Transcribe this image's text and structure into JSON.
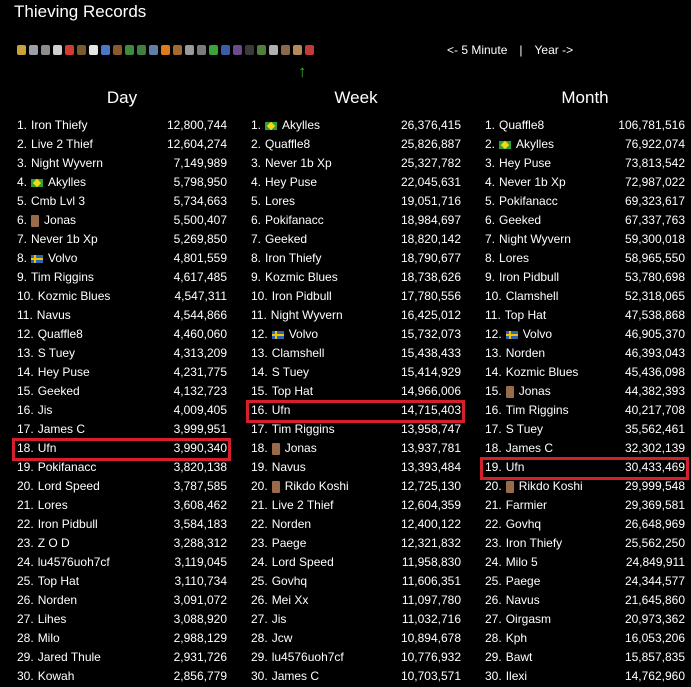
{
  "title": "Thieving Records",
  "skill_icons": [
    {
      "name": "overall-icon",
      "color": "#c9a23a"
    },
    {
      "name": "attack-icon",
      "color": "#9aa0a6"
    },
    {
      "name": "defence-icon",
      "color": "#8c8c8c"
    },
    {
      "name": "strength-icon",
      "color": "#cfcfcf"
    },
    {
      "name": "hitpoints-icon",
      "color": "#d33b2c"
    },
    {
      "name": "ranged-icon",
      "color": "#7a5a2a"
    },
    {
      "name": "prayer-icon",
      "color": "#e6e6e6"
    },
    {
      "name": "magic-icon",
      "color": "#4a78c7"
    },
    {
      "name": "cooking-icon",
      "color": "#8b5a2b"
    },
    {
      "name": "woodcutting-icon",
      "color": "#3c8c3c"
    },
    {
      "name": "fletching-icon",
      "color": "#3f7f3f"
    },
    {
      "name": "fishing-icon",
      "color": "#5f7fa8"
    },
    {
      "name": "firemaking-icon",
      "color": "#e07b1a"
    },
    {
      "name": "crafting-icon",
      "color": "#a36a2e"
    },
    {
      "name": "smithing-icon",
      "color": "#9a9a9a"
    },
    {
      "name": "mining-icon",
      "color": "#7a7a7a"
    },
    {
      "name": "herblore-icon",
      "color": "#3aa53a"
    },
    {
      "name": "agility-icon",
      "color": "#3b5da8"
    },
    {
      "name": "thieving-icon",
      "color": "#6a4c8c"
    },
    {
      "name": "slayer-icon",
      "color": "#3a3a3a"
    },
    {
      "name": "farming-icon",
      "color": "#4f7f3a"
    },
    {
      "name": "runecraft-icon",
      "color": "#b0b0b0"
    },
    {
      "name": "hunter-icon",
      "color": "#8a6a4a"
    },
    {
      "name": "construction-icon",
      "color": "#b58a5a"
    },
    {
      "name": "ehp-icon",
      "color": "#c23b3b"
    }
  ],
  "nav": {
    "prev": "<- 5 Minute",
    "separator": "|",
    "next": "Year ->"
  },
  "columns": [
    {
      "title": "Day",
      "rows": [
        {
          "rank": "1.",
          "name": "Iron Thiefy",
          "value": "12,800,744"
        },
        {
          "rank": "2.",
          "name": "Live 2 Thief",
          "value": "12,604,274"
        },
        {
          "rank": "3.",
          "name": "Night Wyvern",
          "value": "7,149,989"
        },
        {
          "rank": "4.",
          "name": "Akylles",
          "value": "5,798,950",
          "flag": "br"
        },
        {
          "rank": "5.",
          "name": "Cmb Lvl 3",
          "value": "5,734,663"
        },
        {
          "rank": "6.",
          "name": "Jonas",
          "value": "5,500,407",
          "avatar": true
        },
        {
          "rank": "7.",
          "name": "Never 1b Xp",
          "value": "5,269,850"
        },
        {
          "rank": "8.",
          "name": "Volvo",
          "value": "4,801,559",
          "flag": "se"
        },
        {
          "rank": "9.",
          "name": "Tim Riggins",
          "value": "4,617,485"
        },
        {
          "rank": "10.",
          "name": "Kozmic Blues",
          "value": "4,547,311"
        },
        {
          "rank": "11.",
          "name": "Navus",
          "value": "4,544,866"
        },
        {
          "rank": "12.",
          "name": "Quaffle8",
          "value": "4,460,060"
        },
        {
          "rank": "13.",
          "name": "S Tuey",
          "value": "4,313,209"
        },
        {
          "rank": "14.",
          "name": "Hey Puse",
          "value": "4,231,775"
        },
        {
          "rank": "15.",
          "name": "Geeked",
          "value": "4,132,723"
        },
        {
          "rank": "16.",
          "name": "Jis",
          "value": "4,009,405"
        },
        {
          "rank": "17.",
          "name": "James C",
          "value": "3,999,951"
        },
        {
          "rank": "18.",
          "name": "Ufn",
          "value": "3,990,340",
          "highlight": true
        },
        {
          "rank": "19.",
          "name": "Pokifanacc",
          "value": "3,820,138"
        },
        {
          "rank": "20.",
          "name": "Lord Speed",
          "value": "3,787,585"
        },
        {
          "rank": "21.",
          "name": "Lores",
          "value": "3,608,462"
        },
        {
          "rank": "22.",
          "name": "Iron Pidbull",
          "value": "3,584,183"
        },
        {
          "rank": "23.",
          "name": "Z O D",
          "value": "3,288,312"
        },
        {
          "rank": "24.",
          "name": "lu4576uoh7cf",
          "value": "3,119,045"
        },
        {
          "rank": "25.",
          "name": "Top Hat",
          "value": "3,110,734"
        },
        {
          "rank": "26.",
          "name": "Norden",
          "value": "3,091,072"
        },
        {
          "rank": "27.",
          "name": "Lihes",
          "value": "3,088,920"
        },
        {
          "rank": "28.",
          "name": "Milo",
          "value": "2,988,129"
        },
        {
          "rank": "29.",
          "name": "Jared Thule",
          "value": "2,931,726"
        },
        {
          "rank": "30.",
          "name": "Kowah",
          "value": "2,856,779"
        }
      ]
    },
    {
      "title": "Week",
      "rows": [
        {
          "rank": "1.",
          "name": "Akylles",
          "value": "26,376,415",
          "flag": "br"
        },
        {
          "rank": "2.",
          "name": "Quaffle8",
          "value": "25,826,887"
        },
        {
          "rank": "3.",
          "name": "Never 1b Xp",
          "value": "25,327,782"
        },
        {
          "rank": "4.",
          "name": "Hey Puse",
          "value": "22,045,631"
        },
        {
          "rank": "5.",
          "name": "Lores",
          "value": "19,051,716"
        },
        {
          "rank": "6.",
          "name": "Pokifanacc",
          "value": "18,984,697"
        },
        {
          "rank": "7.",
          "name": "Geeked",
          "value": "18,820,142"
        },
        {
          "rank": "8.",
          "name": "Iron Thiefy",
          "value": "18,790,677"
        },
        {
          "rank": "9.",
          "name": "Kozmic Blues",
          "value": "18,738,626"
        },
        {
          "rank": "10.",
          "name": "Iron Pidbull",
          "value": "17,780,556"
        },
        {
          "rank": "11.",
          "name": "Night Wyvern",
          "value": "16,425,012"
        },
        {
          "rank": "12.",
          "name": "Volvo",
          "value": "15,732,073",
          "flag": "se"
        },
        {
          "rank": "13.",
          "name": "Clamshell",
          "value": "15,438,433"
        },
        {
          "rank": "14.",
          "name": "S Tuey",
          "value": "15,414,929"
        },
        {
          "rank": "15.",
          "name": "Top Hat",
          "value": "14,966,006"
        },
        {
          "rank": "16.",
          "name": "Ufn",
          "value": "14,715,403",
          "highlight": true
        },
        {
          "rank": "17.",
          "name": "Tim Riggins",
          "value": "13,958,747"
        },
        {
          "rank": "18.",
          "name": "Jonas",
          "value": "13,937,781",
          "avatar": true
        },
        {
          "rank": "19.",
          "name": "Navus",
          "value": "13,393,484"
        },
        {
          "rank": "20.",
          "name": "Rikdo Koshi",
          "value": "12,725,130",
          "avatar": true
        },
        {
          "rank": "21.",
          "name": "Live 2 Thief",
          "value": "12,604,359"
        },
        {
          "rank": "22.",
          "name": "Norden",
          "value": "12,400,122"
        },
        {
          "rank": "23.",
          "name": "Paege",
          "value": "12,321,832"
        },
        {
          "rank": "24.",
          "name": "Lord Speed",
          "value": "11,958,830"
        },
        {
          "rank": "25.",
          "name": "Govhq",
          "value": "11,606,351"
        },
        {
          "rank": "26.",
          "name": "Mei Xx",
          "value": "11,097,780"
        },
        {
          "rank": "27.",
          "name": "Jis",
          "value": "11,032,716"
        },
        {
          "rank": "28.",
          "name": "Jcw",
          "value": "10,894,678"
        },
        {
          "rank": "29.",
          "name": "lu4576uoh7cf",
          "value": "10,776,932"
        },
        {
          "rank": "30.",
          "name": "James C",
          "value": "10,703,571"
        }
      ]
    },
    {
      "title": "Month",
      "rows": [
        {
          "rank": "1.",
          "name": "Quaffle8",
          "value": "106,781,516"
        },
        {
          "rank": "2.",
          "name": "Akylles",
          "value": "76,922,074",
          "flag": "br"
        },
        {
          "rank": "3.",
          "name": "Hey Puse",
          "value": "73,813,542"
        },
        {
          "rank": "4.",
          "name": "Never 1b Xp",
          "value": "72,987,022"
        },
        {
          "rank": "5.",
          "name": "Pokifanacc",
          "value": "69,323,617"
        },
        {
          "rank": "6.",
          "name": "Geeked",
          "value": "67,337,763"
        },
        {
          "rank": "7.",
          "name": "Night Wyvern",
          "value": "59,300,018"
        },
        {
          "rank": "8.",
          "name": "Lores",
          "value": "58,965,550"
        },
        {
          "rank": "9.",
          "name": "Iron Pidbull",
          "value": "53,780,698"
        },
        {
          "rank": "10.",
          "name": "Clamshell",
          "value": "52,318,065"
        },
        {
          "rank": "11.",
          "name": "Top Hat",
          "value": "47,538,868"
        },
        {
          "rank": "12.",
          "name": "Volvo",
          "value": "46,905,370",
          "flag": "se"
        },
        {
          "rank": "13.",
          "name": "Norden",
          "value": "46,393,043"
        },
        {
          "rank": "14.",
          "name": "Kozmic Blues",
          "value": "45,436,098"
        },
        {
          "rank": "15.",
          "name": "Jonas",
          "value": "44,382,393",
          "avatar": true
        },
        {
          "rank": "16.",
          "name": "Tim Riggins",
          "value": "40,217,708"
        },
        {
          "rank": "17.",
          "name": "S Tuey",
          "value": "35,562,461"
        },
        {
          "rank": "18.",
          "name": "James C",
          "value": "32,302,139"
        },
        {
          "rank": "19.",
          "name": "Ufn",
          "value": "30,433,469",
          "highlight": true
        },
        {
          "rank": "20.",
          "name": "Rikdo Koshi",
          "value": "29,999,548",
          "avatar": true
        },
        {
          "rank": "21.",
          "name": "Farmier",
          "value": "29,369,581"
        },
        {
          "rank": "22.",
          "name": "Govhq",
          "value": "26,648,969"
        },
        {
          "rank": "23.",
          "name": "Iron Thiefy",
          "value": "25,562,250"
        },
        {
          "rank": "24.",
          "name": "Milo 5",
          "value": "24,849,911"
        },
        {
          "rank": "25.",
          "name": "Paege",
          "value": "24,344,577"
        },
        {
          "rank": "26.",
          "name": "Navus",
          "value": "21,645,860"
        },
        {
          "rank": "27.",
          "name": "Oirgasm",
          "value": "20,973,362"
        },
        {
          "rank": "28.",
          "name": "Kph",
          "value": "16,053,206"
        },
        {
          "rank": "29.",
          "name": "Bawt",
          "value": "15,857,835"
        },
        {
          "rank": "30.",
          "name": "Ilexi",
          "value": "14,762,960"
        }
      ]
    }
  ]
}
